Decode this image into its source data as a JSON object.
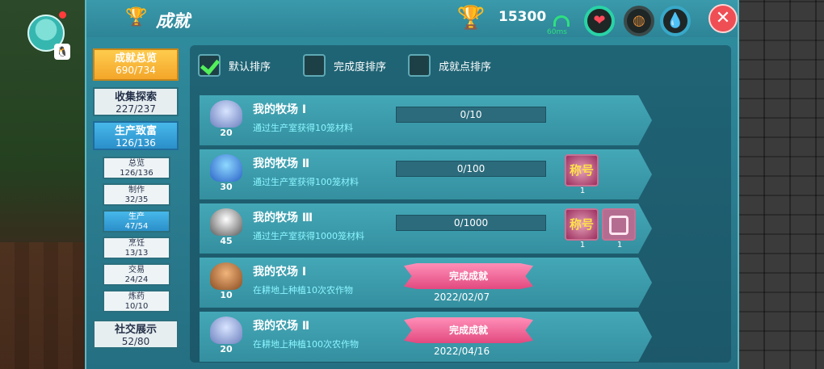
{
  "title": "成就",
  "trophy_icon": "trophy-icon",
  "coins": "15300",
  "ping": "60ms",
  "status_icons": [
    "heart-icon",
    "bread-icon",
    "water-drop-icon"
  ],
  "close_label": "✕",
  "categories": [
    {
      "name": "成就总览",
      "count": "690/734",
      "style": "gold"
    },
    {
      "name": "收集探索",
      "count": "227/237",
      "style": "plain"
    },
    {
      "name": "生产致富",
      "count": "126/136",
      "style": "blue"
    },
    {
      "name": "社交展示",
      "count": "52/80",
      "style": "plain"
    }
  ],
  "subcategories": [
    {
      "name": "总览",
      "count": "126/136"
    },
    {
      "name": "制作",
      "count": "32/35"
    },
    {
      "name": "生产",
      "count": "47/54",
      "active": true
    },
    {
      "name": "烹饪",
      "count": "13/13"
    },
    {
      "name": "交易",
      "count": "24/24"
    },
    {
      "name": "炼药",
      "count": "10/10"
    }
  ],
  "sort_options": [
    {
      "label": "默认排序",
      "checked": true
    },
    {
      "label": "完成度排序",
      "checked": false
    },
    {
      "label": "成就点排序",
      "checked": false
    }
  ],
  "achievements": [
    {
      "title": "我的牧场 Ⅰ",
      "desc": "通过生产室获得10笼材料",
      "points": "20",
      "medal": "silver",
      "progress": "0/10",
      "rewards": []
    },
    {
      "title": "我的牧场 Ⅱ",
      "desc": "通过生产室获得100笼材料",
      "points": "30",
      "medal": "blue",
      "progress": "0/100",
      "rewards": [
        {
          "label": "称号",
          "count": "1"
        }
      ]
    },
    {
      "title": "我的牧场 Ⅲ",
      "desc": "通过生产室获得1000笼材料",
      "points": "45",
      "medal": "white",
      "progress": "0/1000",
      "rewards": [
        {
          "label": "称号",
          "count": "1"
        },
        {
          "label": "",
          "count": "1"
        }
      ]
    },
    {
      "title": "我的农场 Ⅰ",
      "desc": "在耕地上种植10次农作物",
      "points": "10",
      "medal": "bronze",
      "done_label": "完成成就",
      "done_date": "2022/02/07"
    },
    {
      "title": "我的农场 Ⅱ",
      "desc": "在耕地上种植100次农作物",
      "points": "20",
      "medal": "silver",
      "done_label": "完成成就",
      "done_date": "2022/04/16"
    }
  ]
}
